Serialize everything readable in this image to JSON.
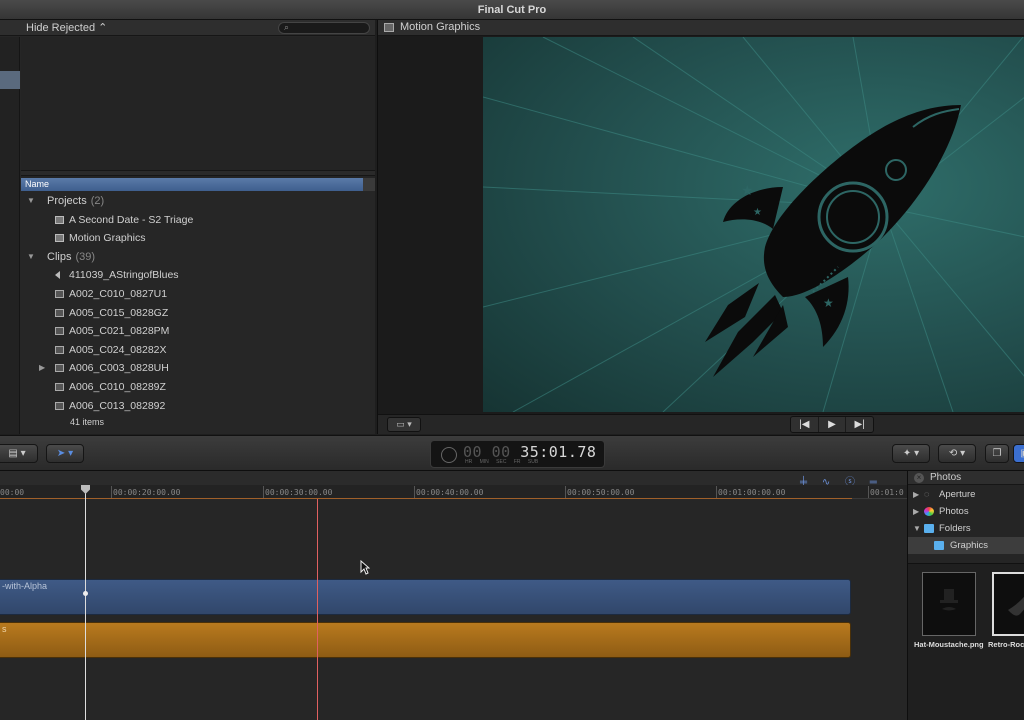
{
  "app": {
    "title": "Final Cut Pro"
  },
  "browser": {
    "filter": "Hide Rejected ⌃",
    "column_name": "Name",
    "groups": [
      {
        "label": "Projects",
        "count": "(2)"
      },
      {
        "label": "Clips",
        "count": "(39)"
      }
    ],
    "projects": [
      "A Second Date - S2 Triage",
      "Motion Graphics"
    ],
    "clips": [
      "411039_AStringofBlues",
      "A002_C010_0827U1",
      "A005_C015_0828GZ",
      "A005_C021_0828PM",
      "A005_C024_08282X",
      "A006_C003_0828UH",
      "A006_C010_08289Z",
      "A006_C013_082892"
    ],
    "items_count": "41 items"
  },
  "viewer": {
    "title": "Motion Graphics",
    "transport": {
      "prev": "|◀",
      "play": "▶",
      "next": "▶|"
    }
  },
  "toolbar": {
    "timecode": {
      "dim": "00 00 ",
      "main": "35:01.78",
      "units": "HR MIN SEC FR SUB"
    }
  },
  "timeline": {
    "ruler": [
      "00:00",
      "00:00:20:00.00",
      "00:00:30:00.00",
      "00:00:40:00.00",
      "00:00:50:00.00",
      "00:01:00:00.00",
      "00:01:0"
    ],
    "clips": {
      "blue": "-with-Alpha",
      "orange": "s"
    }
  },
  "media_browser": {
    "title": "Photos",
    "sources": [
      "Aperture",
      "Photos",
      "Folders",
      "Graphics"
    ],
    "thumbs": [
      "Hat-Moustache.png",
      "Retro-Roc"
    ]
  },
  "colors": {
    "accent": "#3f5f8e",
    "playhead": "#e06060",
    "connected_clip": "#3f5a86",
    "audio_clip": "#b97a1e"
  }
}
